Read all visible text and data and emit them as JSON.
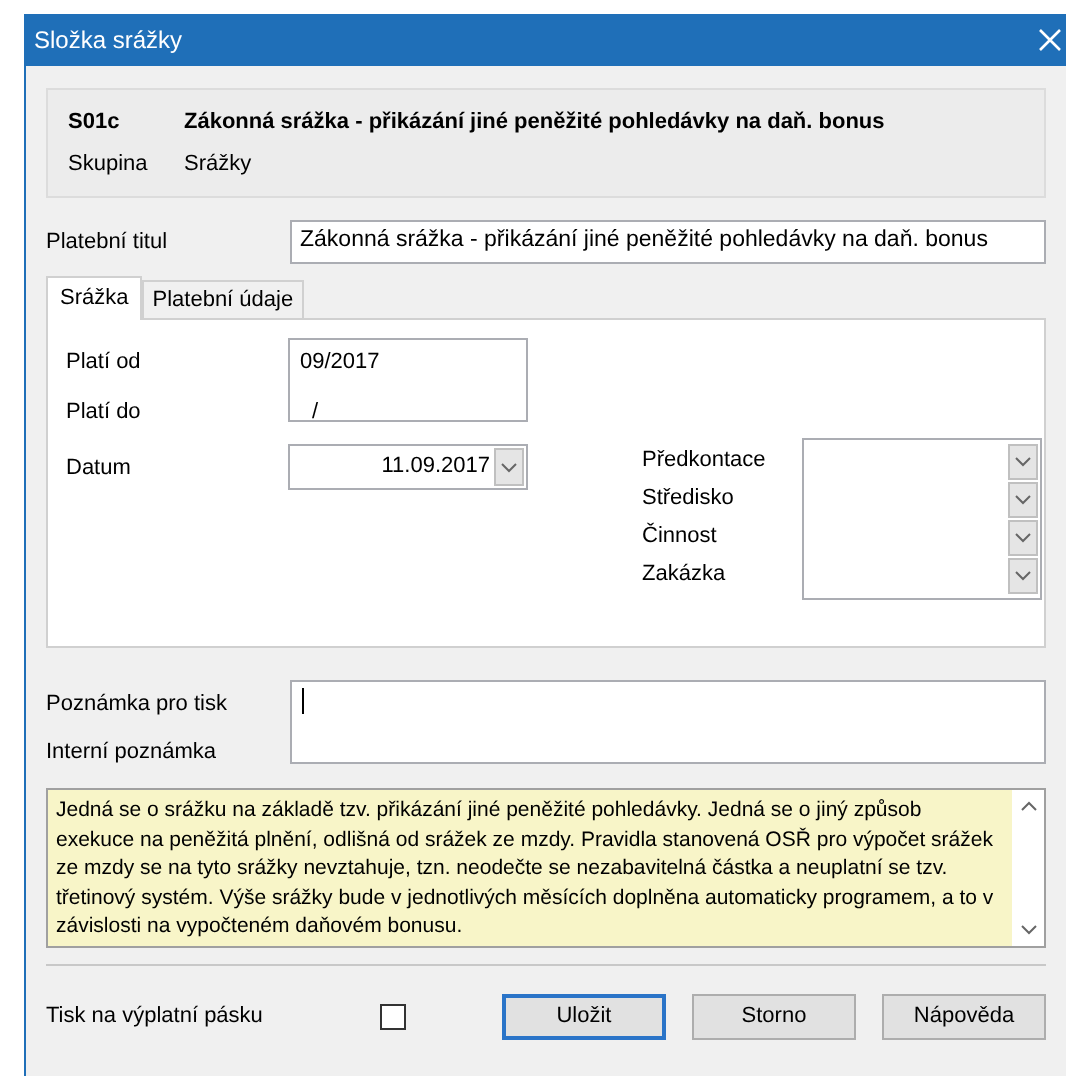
{
  "window": {
    "title": "Složka srážky"
  },
  "header": {
    "code": "S01c",
    "name": "Zákonná srážka - přikázání jiné peněžité pohledávky na daň. bonus",
    "group_label": "Skupina",
    "group_value": "Srážky"
  },
  "payment_title": {
    "label": "Platební titul",
    "value": "Zákonná srážka - přikázání jiné peněžité pohledávky na daň. bonus"
  },
  "tabs": [
    {
      "label": "Srážka",
      "selected": true
    },
    {
      "label": "Platební údaje",
      "selected": false
    }
  ],
  "validity": {
    "from_label": "Platí od",
    "from_value": "09/2017",
    "to_label": "Platí do",
    "to_value": "/"
  },
  "date": {
    "label": "Datum",
    "value": "11.09.2017"
  },
  "lookups": [
    {
      "label": "Předkontace"
    },
    {
      "label": "Středisko"
    },
    {
      "label": "Činnost"
    },
    {
      "label": "Zakázka"
    }
  ],
  "notes": {
    "print_label": "Poznámka pro tisk",
    "internal_label": "Interní poznámka"
  },
  "description": "Jedná se o srážku na základě tzv. přikázání jiné peněžité pohledávky. Jedná se o jiný způsob exekuce na peněžitá plnění, odlišná od srážek ze mzdy. Pravidla stanovená OSŘ pro výpočet srážek ze mzdy se na tyto srážky nevztahuje, tzn. neodečte se nezabavitelná částka a neuplatní se tzv. třetinový systém. Výše srážky bude v jednotlivých měsících doplněna automaticky programem, a to v závislosti na vypočteném daňovém bonusu.",
  "print_on_payslip": {
    "label": "Tisk na výplatní pásku",
    "checked": false
  },
  "buttons": [
    {
      "label": "Uložit",
      "kind": "default"
    },
    {
      "label": "Storno",
      "kind": "normal"
    },
    {
      "label": "Nápověda",
      "kind": "normal"
    }
  ]
}
